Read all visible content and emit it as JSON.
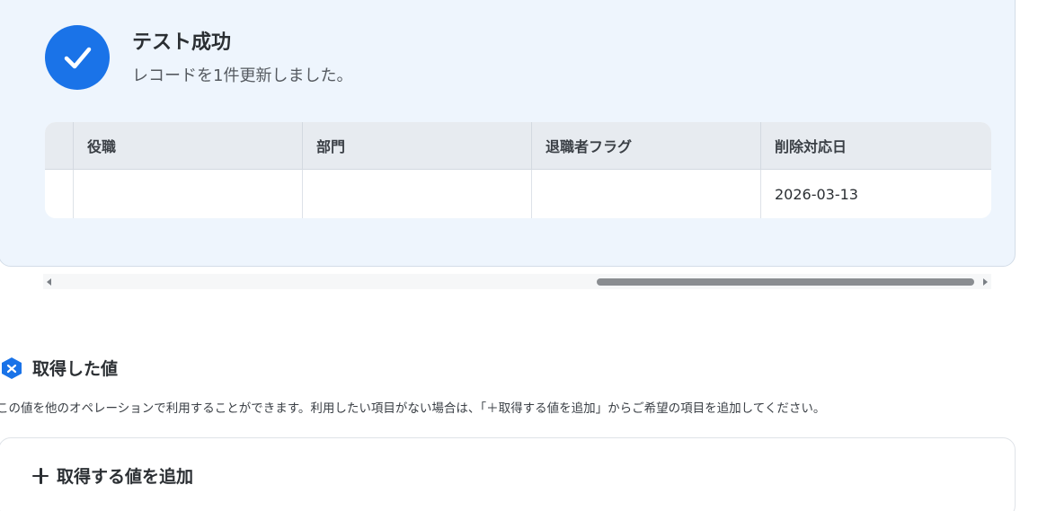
{
  "result": {
    "title": "テスト成功",
    "message": "レコードを1件更新しました。",
    "icon": "check-circle-icon",
    "accent_color": "#1a73e8"
  },
  "table": {
    "columns": [
      "",
      "役職",
      "部門",
      "退職者フラグ",
      "削除対応日"
    ],
    "rows": [
      [
        "",
        "",
        "",
        "",
        "2026-03-13"
      ]
    ]
  },
  "acquired": {
    "icon": "acquired-value-icon",
    "title": "取得した値",
    "description": "この値を他のオペレーションで利用することができます。利用したい項目がない場合は、「＋取得する値を追加」からご希望の項目を追加してください。",
    "add_button_label": "取得する値を追加",
    "add_icon": "plus-icon"
  }
}
